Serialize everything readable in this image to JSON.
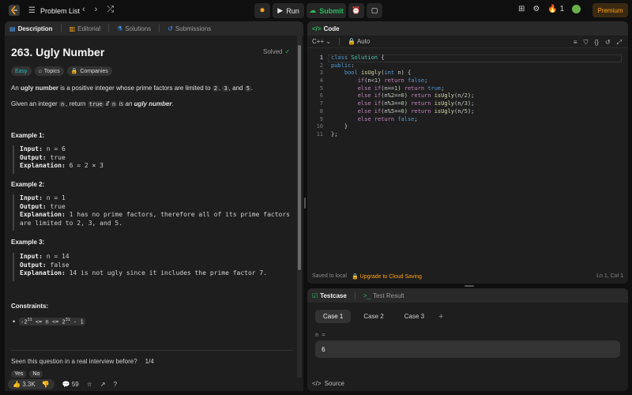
{
  "topbar": {
    "problem_list": "Problem List",
    "run": "Run",
    "submit": "Submit",
    "streak": "1",
    "premium": "Premium"
  },
  "left": {
    "tabs": [
      "Description",
      "Editorial",
      "Solutions",
      "Submissions"
    ],
    "title": "263. Ugly Number",
    "solved": "Solved",
    "tags": [
      "Easy",
      "Topics",
      "Companies"
    ],
    "p1_pre": "An ",
    "p1_bold": "ugly number",
    "p1_mid": " is a positive integer whose prime factors are limited to ",
    "p1_c1": "2",
    "p1_c2": "3",
    "p1_and": ", and ",
    "p1_c3": "5",
    "p1_comma": ", ",
    "p1_end": ".",
    "p2_pre": "Given an integer ",
    "p2_n": "n",
    "p2_mid": ", return ",
    "p2_true": "true",
    "p2_if": " if ",
    "p2_n2": "n",
    "p2_is": " is an ",
    "p2_bold": "ugly number",
    "p2_end": ".",
    "examples": [
      {
        "title": "Example 1:",
        "input_label": "Input:",
        "input": " n = 6",
        "output_label": "Output:",
        "output": " true",
        "expl_label": "Explanation:",
        "expl": " 6 = 2 × 3",
        "expl2": ""
      },
      {
        "title": "Example 2:",
        "input_label": "Input:",
        "input": " n = 1",
        "output_label": "Output:",
        "output": " true",
        "expl_label": "Explanation:",
        "expl": " 1 has no prime factors, therefore all of its prime factors",
        "expl2": "are limited to 2, 3, and 5."
      },
      {
        "title": "Example 3:",
        "input_label": "Input:",
        "input": " n = 14",
        "output_label": "Output:",
        "output": " false",
        "expl_label": "Explanation:",
        "expl": " 14 is not ugly since it includes the prime factor 7.",
        "expl2": ""
      }
    ],
    "constraints_title": "Constraints:",
    "constraint_pre": "-2",
    "constraint_exp1": "31",
    "constraint_mid": " <= n <= 2",
    "constraint_exp2": "31",
    "constraint_end": " - 1",
    "seen_question": "Seen this question in a real interview before?",
    "seen_count": "1/4",
    "yes": "Yes",
    "no": "No",
    "likes": "3.3K",
    "comments": "59"
  },
  "code": {
    "title": "Code",
    "lang": "C++",
    "auto": "Auto",
    "lines": [
      "class Solution {",
      "public:",
      "    bool isUgly(int n) {",
      "        if(n<1) return false;",
      "        else if(n==1) return true;",
      "        else if(n%2==0) return isUgly(n/2);",
      "        else if(n%3==0) return isUgly(n/3);",
      "        else if(n%5==0) return isUgly(n/5);",
      "        else return false;",
      "    }",
      "};"
    ],
    "line_numbers": [
      "1",
      "2",
      "3",
      "4",
      "5",
      "6",
      "7",
      "8",
      "9",
      "10",
      "11"
    ],
    "saved": "Saved to local",
    "upgrade": "Upgrade to Cloud Saving",
    "position": "Ln 1, Col 1"
  },
  "test": {
    "tabs": [
      "Testcase",
      "Test Result"
    ],
    "cases": [
      "Case 1",
      "Case 2",
      "Case 3"
    ],
    "input_label": "n =",
    "input_value": "6",
    "source": "Source"
  },
  "colors": {
    "accent": "#ffa116",
    "success": "#2cbb5d",
    "easy": "#1cbaba"
  }
}
